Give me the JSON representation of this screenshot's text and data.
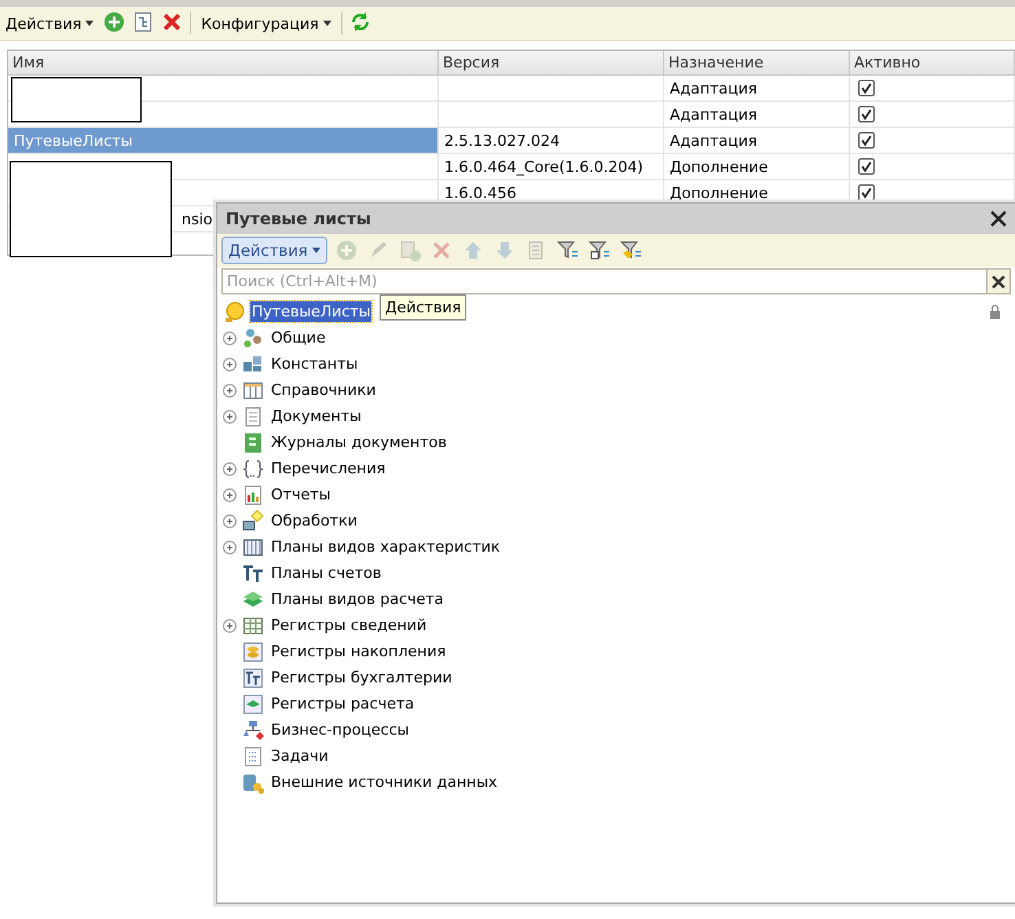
{
  "toolbar": {
    "actions_menu": "Действия",
    "config_menu": "Конфигурация"
  },
  "table": {
    "columns": [
      "Имя",
      "Версия",
      "Назначение",
      "Активно"
    ],
    "rows": [
      {
        "purpose": "Адаптация",
        "active": true,
        "selected": false
      },
      {
        "purpose": "Адаптация",
        "active": true,
        "selected": false
      },
      {
        "name": "ПутевыеЛисты",
        "version": "2.5.13.027.024",
        "purpose": "Адаптация",
        "active": true,
        "selected": true
      },
      {
        "version": "1.6.0.464_Core(1.6.0.204)",
        "purpose": "Дополнение",
        "active": true,
        "selected": false
      },
      {
        "version": "1.6.0.456",
        "purpose": "Дополнение",
        "active": true,
        "selected": false
      },
      {
        "name": "nsio",
        "redacted": true,
        "selected": false
      }
    ]
  },
  "panel": {
    "title": "Путевые листы",
    "actions_button": "Действия",
    "tools": [
      {
        "disabled": true
      },
      {
        "disabled": true
      },
      {
        "disabled": true
      },
      {
        "disabled": true
      },
      {
        "disabled": true
      },
      {
        "disabled": true
      },
      {
        "disabled": true
      },
      {
        "disabled": false
      },
      {
        "disabled": false
      },
      {
        "disabled": false
      }
    ],
    "search": {
      "placeholder": "Поиск (Ctrl+Alt+M)"
    },
    "tooltip": "Действия",
    "tree": {
      "label": "ПутевыеЛисты",
      "selected": true,
      "children": [
        {
          "label": "Общие",
          "has_children": true
        },
        {
          "label": "Константы",
          "has_children": true
        },
        {
          "label": "Справочники",
          "has_children": true
        },
        {
          "label": "Документы",
          "has_children": true
        },
        {
          "label": "Журналы документов",
          "has_children": false
        },
        {
          "label": "Перечисления",
          "has_children": true
        },
        {
          "label": "Отчеты",
          "has_children": true
        },
        {
          "label": "Обработки",
          "has_children": true
        },
        {
          "label": "Планы видов характеристик",
          "has_children": true
        },
        {
          "label": "Планы счетов",
          "has_children": false
        },
        {
          "label": "Планы видов расчета",
          "has_children": false
        },
        {
          "label": "Регистры сведений",
          "has_children": true
        },
        {
          "label": "Регистры накопления",
          "has_children": false
        },
        {
          "label": "Регистры бухгалтерии",
          "has_children": false
        },
        {
          "label": "Регистры расчета",
          "has_children": false
        },
        {
          "label": "Бизнес-процессы",
          "has_children": false
        },
        {
          "label": "Задачи",
          "has_children": false
        },
        {
          "label": "Внешние источники данных",
          "has_children": false
        }
      ]
    }
  }
}
